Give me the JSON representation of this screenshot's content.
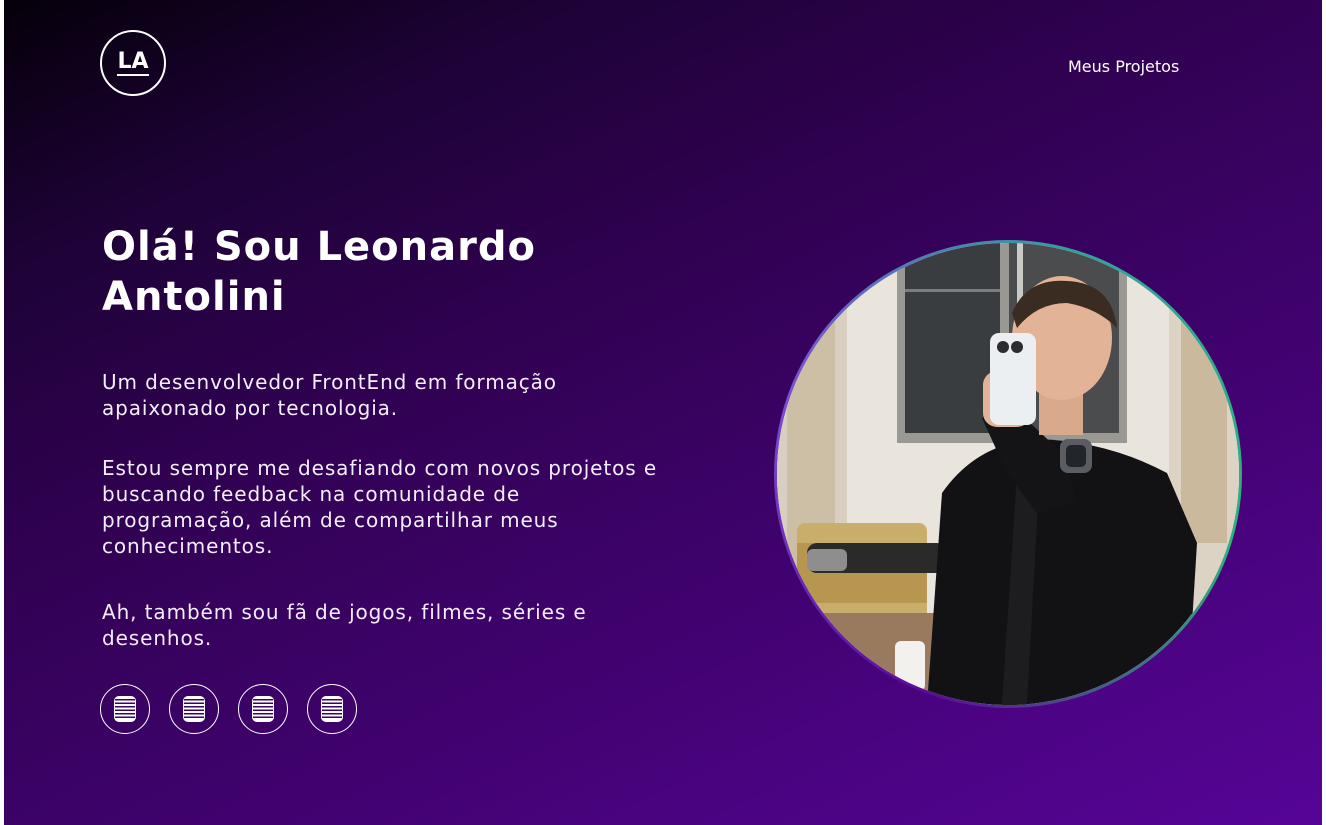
{
  "header": {
    "logo_text": "LA",
    "nav_link": "Meus Projetos"
  },
  "hero": {
    "title": "Olá! Sou Leonardo Antolini",
    "paragraphs": [
      "Um desenvolvedor FrontEnd em formação apaixonado por tecnologia.",
      "Estou sempre me desafiando com novos projetos e buscando feedback na comunidade de programação, além de compartilhar meus conhecimentos.",
      "Ah, também sou fã de jogos, filmes, séries e desenhos."
    ],
    "social_icons": [
      "social-icon",
      "social-icon",
      "social-icon",
      "social-icon"
    ]
  },
  "profile_photo": {
    "subject": "profile-photo"
  },
  "colors": {
    "background_start": "#050009",
    "background_end": "#560496",
    "text": "#ffffff",
    "photo_ring_accent": "#31b07c"
  }
}
